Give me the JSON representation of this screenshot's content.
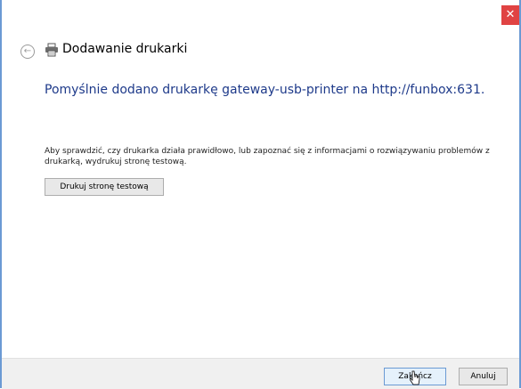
{
  "window": {
    "close_glyph": "✕"
  },
  "header": {
    "title": "Dodawanie drukarki",
    "back_glyph": "←",
    "icon": "printer-icon"
  },
  "content": {
    "success_message": "Pomyślnie dodano drukarkę gateway-usb-printer na http://funbox:631.",
    "instructions": "Aby sprawdzić, czy drukarka działa prawidłowo, lub zapoznać się z informacjami o rozwiązywaniu problemów z drukarką, wydrukuj stronę testową.",
    "test_page_button": "Drukuj stronę testową"
  },
  "footer": {
    "finish_button": "Zakończ",
    "cancel_button": "Anuluj"
  },
  "colors": {
    "accent": "#1e3a8a",
    "close": "#e04343",
    "border": "#6b9ad4"
  }
}
